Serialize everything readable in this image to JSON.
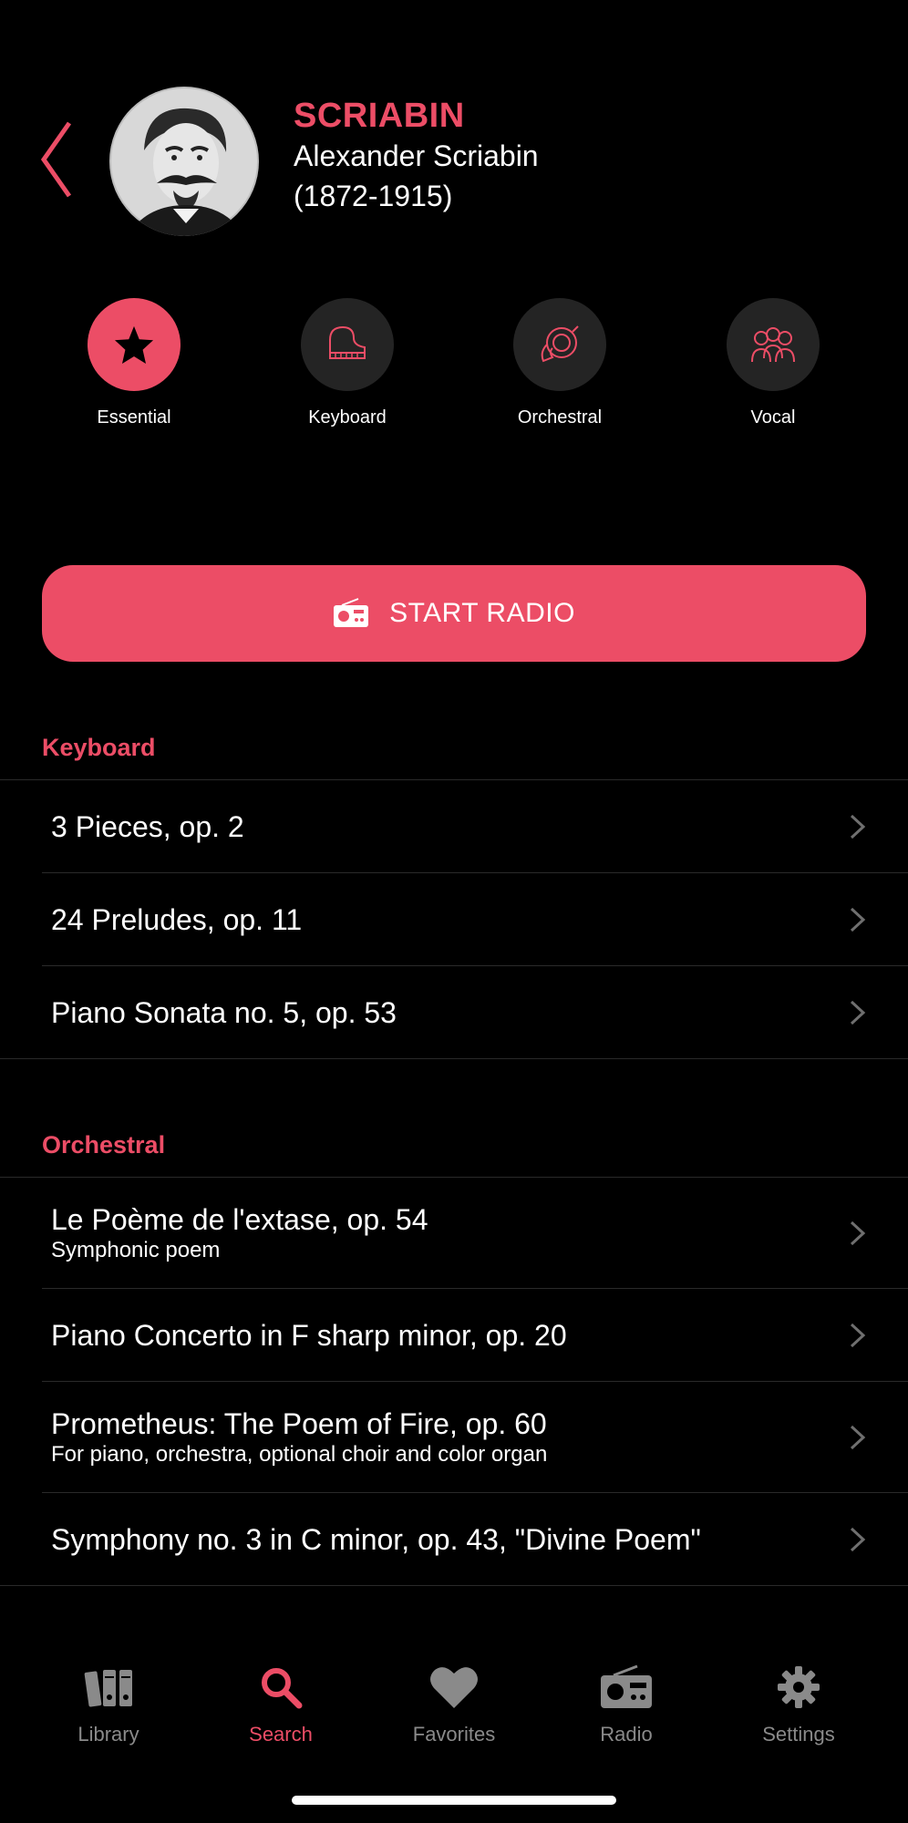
{
  "header": {
    "short_name": "SCRIABIN",
    "full_name": "Alexander Scriabin",
    "dates": "(1872-1915)"
  },
  "categories": [
    {
      "label": "Essential",
      "icon": "star-icon",
      "active": true
    },
    {
      "label": "Keyboard",
      "icon": "piano-icon",
      "active": false
    },
    {
      "label": "Orchestral",
      "icon": "horn-icon",
      "active": false
    },
    {
      "label": "Vocal",
      "icon": "choir-icon",
      "active": false
    }
  ],
  "radio_button": {
    "label": "START RADIO",
    "icon": "radio-icon"
  },
  "sections": [
    {
      "title": "Keyboard",
      "items": [
        {
          "title": "3 Pieces, op. 2",
          "subtitle": ""
        },
        {
          "title": "24 Preludes, op. 11",
          "subtitle": ""
        },
        {
          "title": "Piano Sonata no. 5, op. 53",
          "subtitle": ""
        }
      ]
    },
    {
      "title": "Orchestral",
      "items": [
        {
          "title": "Le Poème de l'extase, op. 54",
          "subtitle": "Symphonic poem"
        },
        {
          "title": "Piano Concerto in F sharp minor, op. 20",
          "subtitle": ""
        },
        {
          "title": "Prometheus: The Poem of Fire, op. 60",
          "subtitle": "For piano, orchestra, optional choir and color organ"
        },
        {
          "title": "Symphony no. 3 in C minor, op. 43, \"Divine Poem\"",
          "subtitle": ""
        }
      ]
    }
  ],
  "tabs": [
    {
      "label": "Library",
      "icon": "library-icon",
      "active": false
    },
    {
      "label": "Search",
      "icon": "search-icon",
      "active": true
    },
    {
      "label": "Favorites",
      "icon": "heart-icon",
      "active": false
    },
    {
      "label": "Radio",
      "icon": "radio-icon",
      "active": false
    },
    {
      "label": "Settings",
      "icon": "gear-icon",
      "active": false
    }
  ],
  "colors": {
    "accent": "#ec4d66",
    "background": "#000000",
    "inactive_tab": "#8a8a8a",
    "circle_bg": "#242424"
  }
}
